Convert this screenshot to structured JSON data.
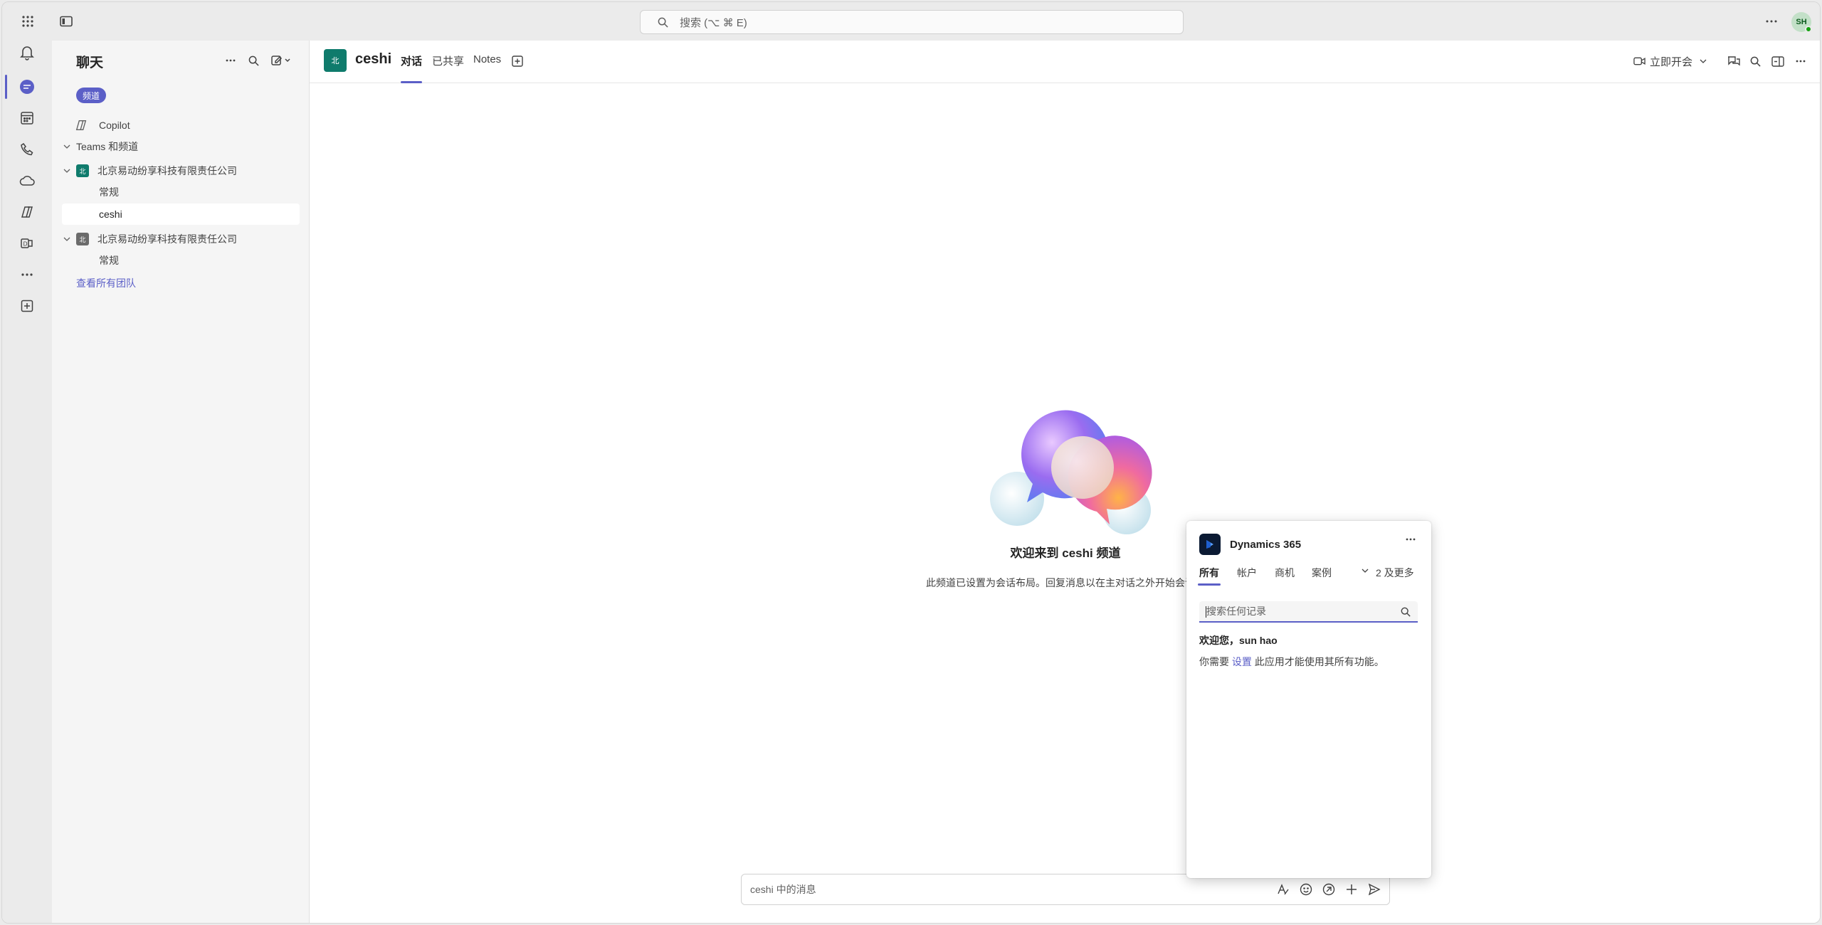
{
  "topbar": {
    "search_placeholder": "搜索 (⌥ ⌘ E)",
    "avatar_initials": "SH"
  },
  "sidebar": {
    "title": "聊天",
    "filter_chip": "频道",
    "copilot": "Copilot",
    "section": "Teams 和频道",
    "teams": [
      {
        "name": "北京易动纷享科技有限责任公司",
        "channels": [
          "常规",
          "ceshi"
        ]
      },
      {
        "name": "北京易动纷享科技有限责任公司",
        "channels": [
          "常规"
        ]
      }
    ],
    "see_all": "查看所有团队"
  },
  "channel": {
    "name": "ceshi",
    "tabs": [
      "对话",
      "已共享",
      "Notes"
    ],
    "meet_now": "立即开会"
  },
  "welcome": {
    "title": "欢迎来到 ceshi 频道",
    "subtitle": "此频道已设置为会话布局。回复消息以在主对话之外开始会话。"
  },
  "compose": {
    "placeholder": "ceshi 中的消息"
  },
  "dynamics": {
    "title": "Dynamics 365",
    "tabs": [
      "所有",
      "帐户",
      "商机",
      "案例"
    ],
    "more_tabs": "2 及更多",
    "search_placeholder": "搜索任何记录",
    "welcome": "欢迎您，sun hao",
    "msg_prefix": "你需要",
    "msg_link": "设置",
    "msg_suffix": "此应用才能使用其所有功能。"
  },
  "colors": {
    "accent": "#5b5fc7",
    "team_teal": "#0f7b6c",
    "team_gray": "#6b6b6b"
  }
}
